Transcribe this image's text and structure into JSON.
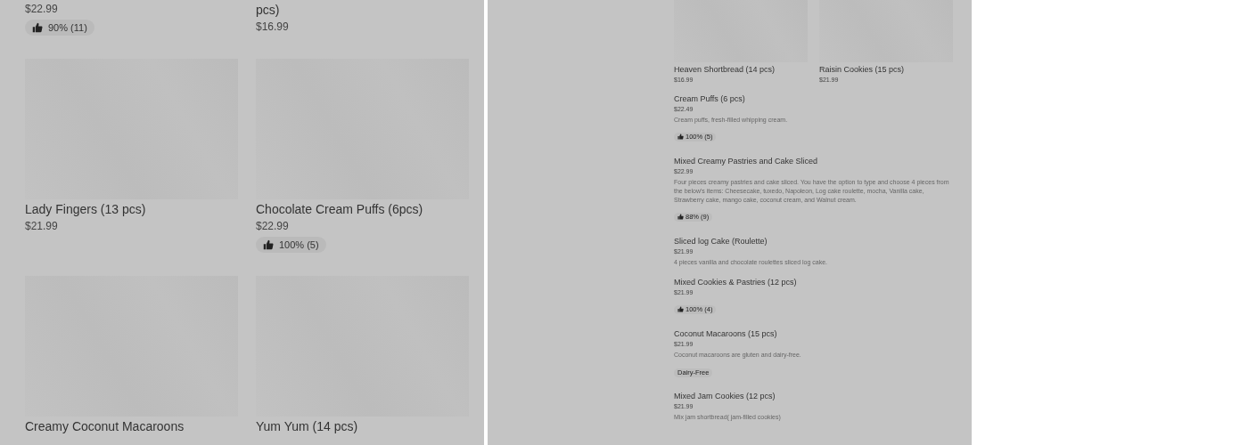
{
  "left_grid": {
    "items": [
      {
        "price": "$22.99",
        "rating": "90% (11)",
        "image": false
      },
      {
        "title": "pcs)",
        "price": "$16.99",
        "image": false
      },
      {
        "title": "Lady Fingers (13 pcs)",
        "price": "$21.99",
        "image": true
      },
      {
        "title": "Chocolate Cream Puffs (6pcs)",
        "price": "$22.99",
        "rating": "100% (5)",
        "image": true
      },
      {
        "title": "Creamy Coconut Macaroons",
        "image": true
      },
      {
        "title": "Yum Yum (14 pcs)",
        "image": true
      }
    ]
  },
  "detail_panel": {
    "featured": [
      {
        "title": "Heaven Shortbread (14 pcs)",
        "price": "$16.99"
      },
      {
        "title": "Raisin Cookies (15 pcs)",
        "price": "$21.99"
      }
    ],
    "list": [
      {
        "title": "Cream Puffs (6 pcs)",
        "price": "$22.49",
        "description": "Cream puffs, fresh-filled whipping cream.",
        "rating": "100% (5)"
      },
      {
        "title": "Mixed Creamy Pastries and Cake Sliced",
        "price": "$22.99",
        "description": "Four pieces creamy pastries and cake sliced.  You have the option to type and choose 4 pieces from the below's items: Cheesecake, tuxedo, Napoleon, Log cake roulette, mocha, Vanilla cake, Strawberry cake, mango cake, coconut cream, and Walnut cream.",
        "rating": "88% (9)"
      },
      {
        "title": "Sliced log Cake (Roulette)",
        "price": "$21.99",
        "description": "4 pieces vanilla and chocolate roulettes sliced log cake."
      },
      {
        "title": "Mixed Cookies & Pastries (12 pcs)",
        "price": "$21.99",
        "rating": "100% (4)"
      },
      {
        "title": "Coconut Macaroons (15 pcs)",
        "price": "$21.99",
        "description": "Coconut macaroons are gluten and dairy-free.",
        "tag": "Dairy-Free"
      },
      {
        "title": "Mixed Jam Cookies (12 pcs)",
        "price": "$21.99",
        "description": "Mix jam shortbread( jam-filled cookies)"
      }
    ]
  }
}
